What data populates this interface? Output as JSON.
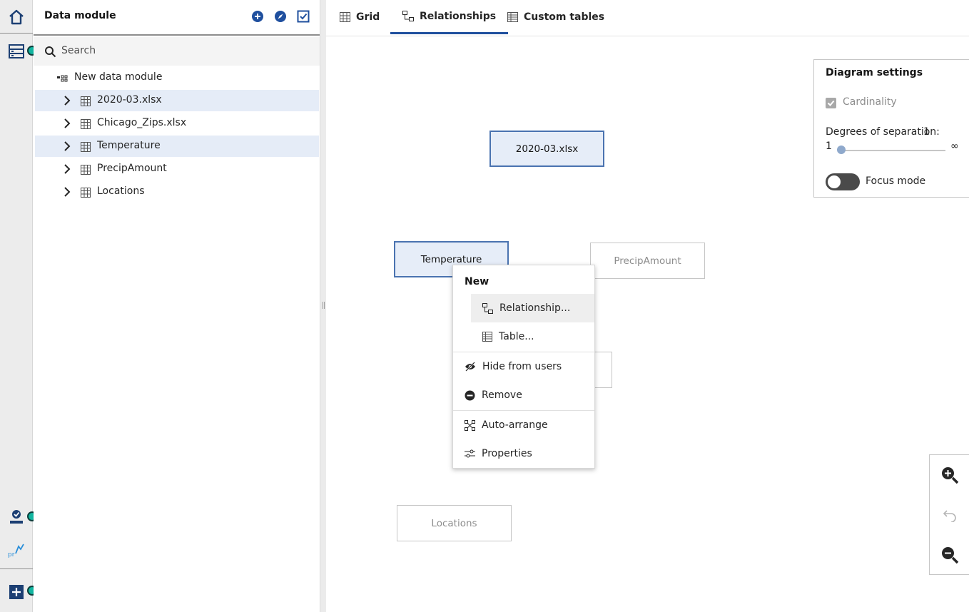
{
  "sidebar": {
    "title": "Data module",
    "search_placeholder": "Search",
    "module_name": "New data module",
    "tables": [
      {
        "label": "2020-03.xlsx",
        "selected": true
      },
      {
        "label": "Chicago_Zips.xlsx",
        "selected": false
      },
      {
        "label": "Temperature",
        "selected": true
      },
      {
        "label": "PrecipAmount",
        "selected": false
      },
      {
        "label": "Locations",
        "selected": false
      }
    ]
  },
  "tabs": [
    {
      "label": "Grid",
      "active": false
    },
    {
      "label": "Relationships",
      "active": true
    },
    {
      "label": "Custom tables",
      "active": false
    }
  ],
  "diagram": {
    "nodes": [
      {
        "label": "2020-03.xlsx",
        "selected": true
      },
      {
        "label": "Temperature",
        "selected": true
      },
      {
        "label": "PrecipAmount",
        "selected": false
      },
      {
        "label": "Locations",
        "selected": false
      }
    ]
  },
  "settings": {
    "title": "Diagram settings",
    "cardinality_label": "Cardinality",
    "cardinality_checked": true,
    "degrees_label": "Degrees of separation:",
    "degrees_value": "1",
    "slider_min": "1",
    "slider_max": "∞",
    "focus_mode_label": "Focus mode",
    "focus_mode_on": false
  },
  "context_menu": {
    "section_title": "New",
    "items": {
      "relationship": "Relationship...",
      "table": "Table...",
      "hide": "Hide from users",
      "remove": "Remove",
      "auto_arrange": "Auto-arrange",
      "properties": "Properties"
    }
  },
  "colors": {
    "accent": "#1f4f9e",
    "selection": "#e5ecf7",
    "status_dot": "#12b5a0"
  }
}
